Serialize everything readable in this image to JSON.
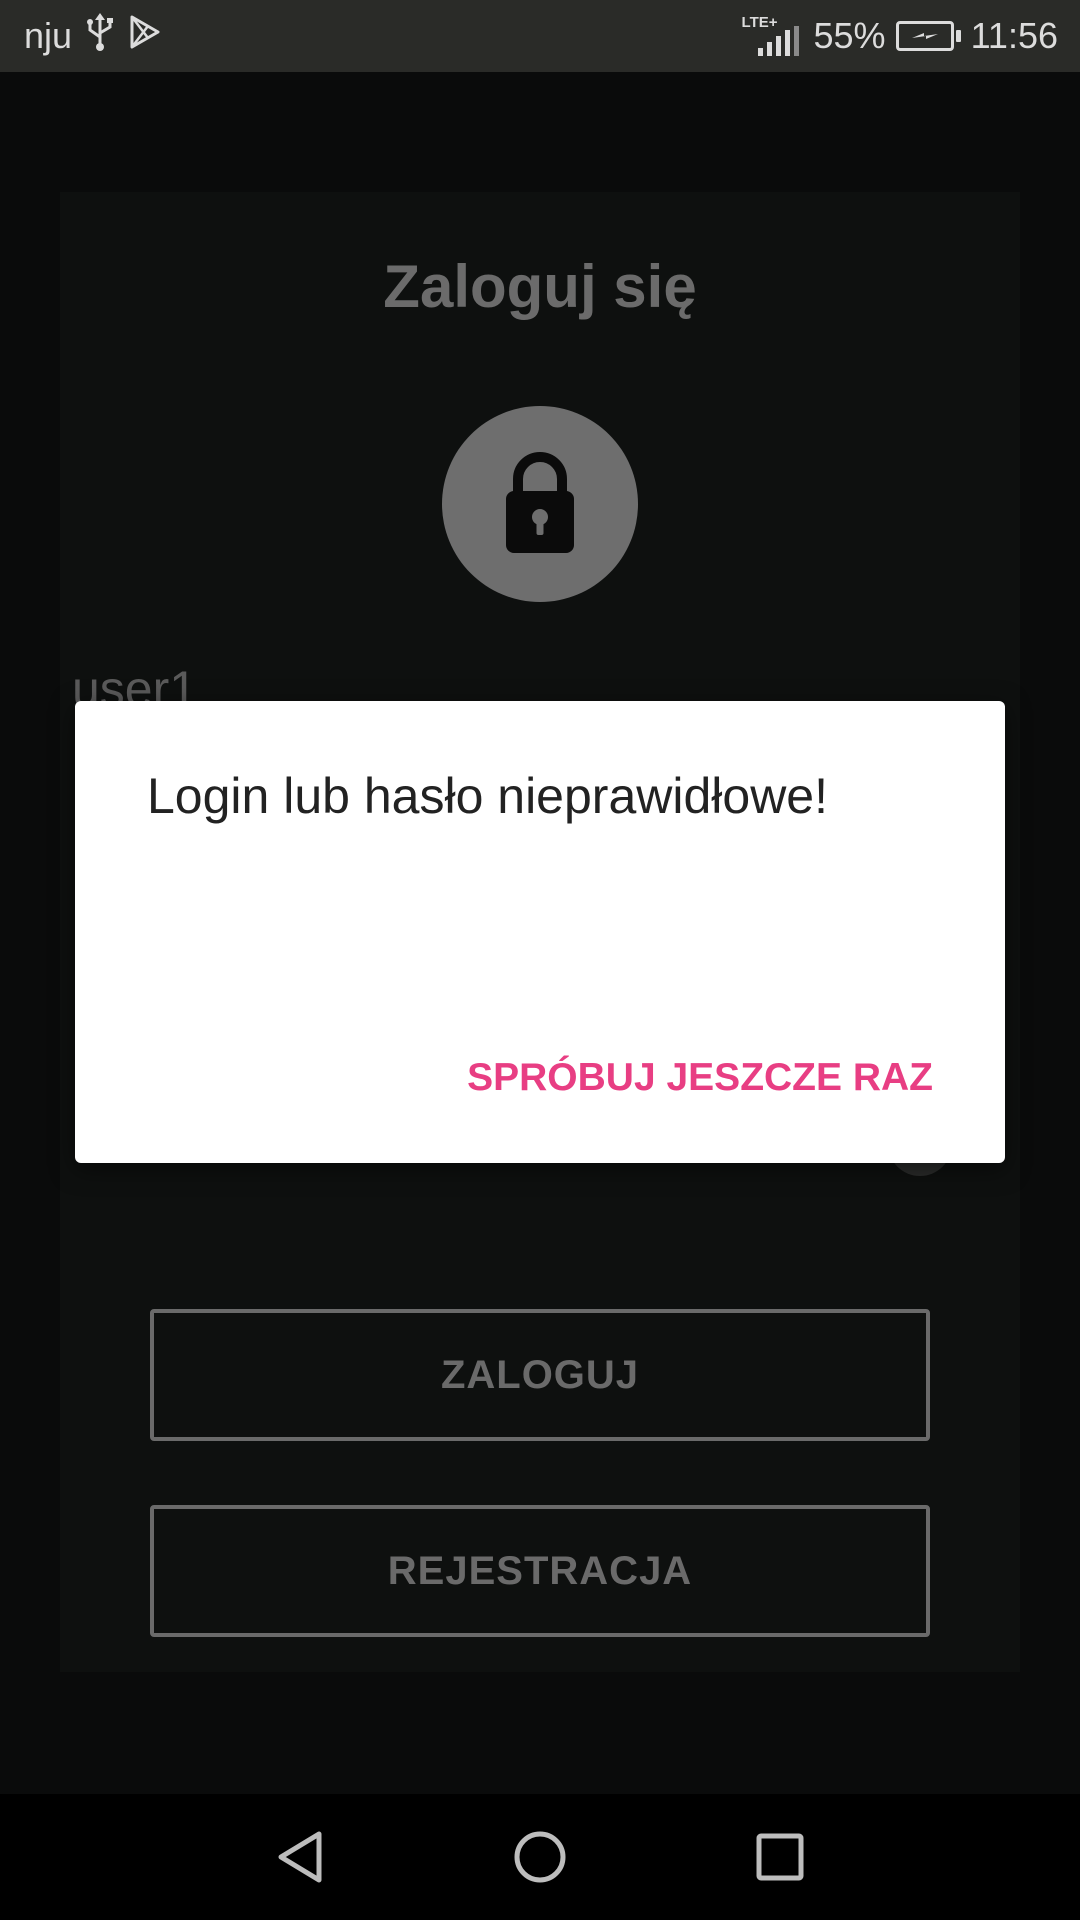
{
  "status_bar": {
    "carrier": "nju",
    "network": "LTE+",
    "battery": "55%",
    "time": "11:56",
    "icons": [
      "usb-icon",
      "play-store-icon",
      "signal-icon",
      "battery-charging-icon"
    ]
  },
  "login_screen": {
    "title": "Zaloguj się",
    "lock_icon": "lock-icon",
    "username_value": "user1",
    "login_button": "ZALOGUJ",
    "register_button": "REJESTRACJA"
  },
  "dialog": {
    "message": "Login lub hasło nieprawidłowe!",
    "action": "SPRÓBUJ JESZCZE RAZ",
    "action_color": "#e83e83"
  },
  "nav_bar": {
    "icons": [
      "back-icon",
      "home-icon",
      "recents-icon"
    ]
  }
}
